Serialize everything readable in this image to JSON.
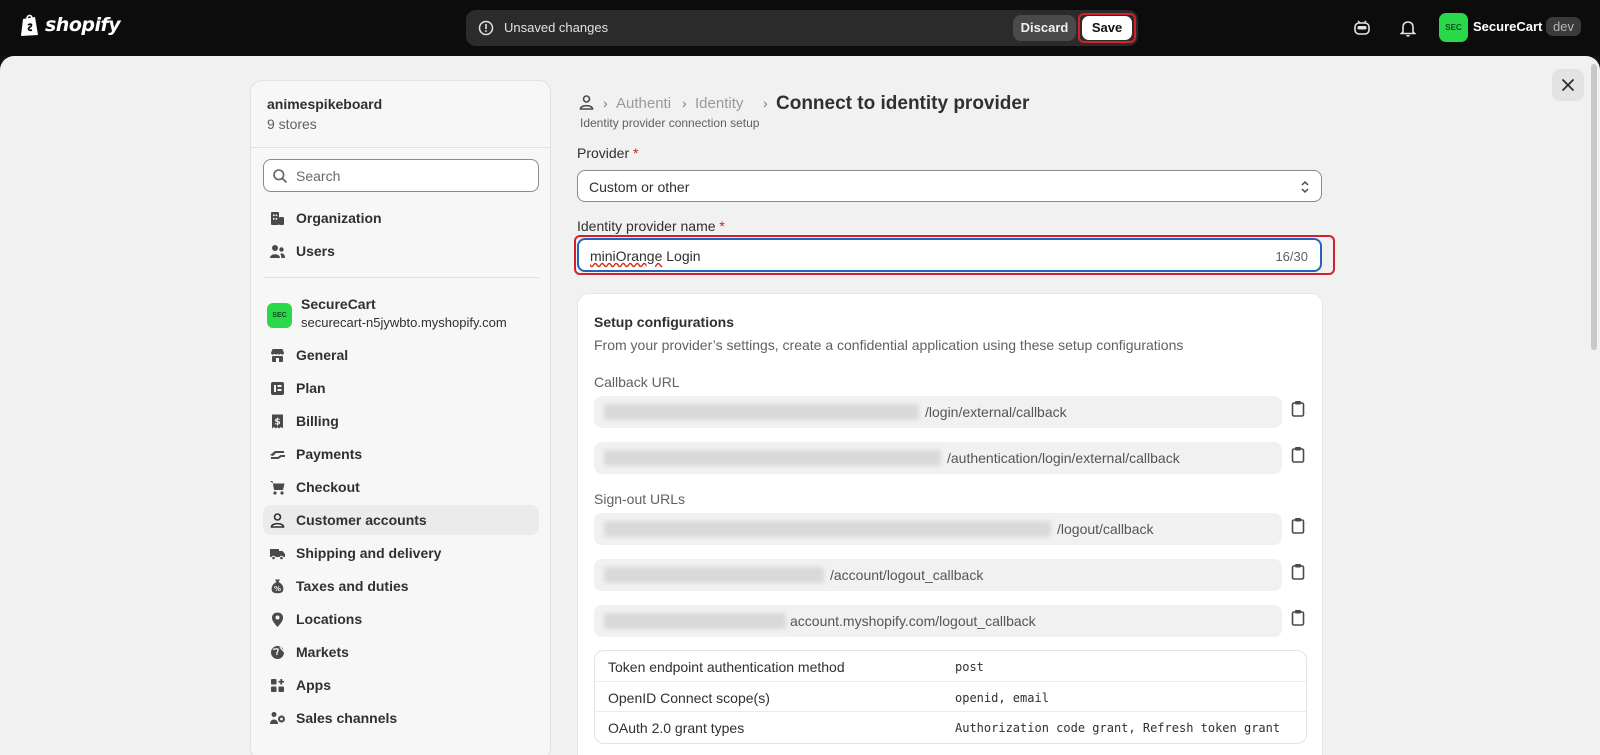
{
  "topbar": {
    "brand": "shopify",
    "unsaved_text": "Unsaved changes",
    "discard_label": "Discard",
    "save_label": "Save",
    "store_avatar": "SEC",
    "store_name": "SecureCart",
    "env_badge": "dev",
    "icons": [
      "shopify-bag-icon",
      "alert-circle-icon",
      "sidekick-icon",
      "bell-icon"
    ]
  },
  "sidebar": {
    "org_name": "animespikeboard",
    "org_stores": "9 stores",
    "search": {
      "placeholder": "Search",
      "value": ""
    },
    "org_items": [
      {
        "label": "Organization",
        "icon": "organization-icon"
      },
      {
        "label": "Users",
        "icon": "users-icon"
      }
    ],
    "store": {
      "avatar": "SEC",
      "name": "SecureCart",
      "domain": "securecart-n5jywbto.myshopify.com"
    },
    "items": [
      {
        "label": "General",
        "icon": "store-icon"
      },
      {
        "label": "Plan",
        "icon": "plan-icon"
      },
      {
        "label": "Billing",
        "icon": "billing-icon"
      },
      {
        "label": "Payments",
        "icon": "payments-icon"
      },
      {
        "label": "Checkout",
        "icon": "cart-icon"
      },
      {
        "label": "Customer accounts",
        "icon": "person-icon",
        "active": true
      },
      {
        "label": "Shipping and delivery",
        "icon": "truck-icon"
      },
      {
        "label": "Taxes and duties",
        "icon": "taxes-icon"
      },
      {
        "label": "Locations",
        "icon": "location-pin-icon"
      },
      {
        "label": "Markets",
        "icon": "globe-icon"
      },
      {
        "label": "Apps",
        "icon": "apps-icon"
      },
      {
        "label": "Sales channels",
        "icon": "sales-channels-icon"
      }
    ]
  },
  "breadcrumbs": {
    "items": [
      "Authenti",
      "Identity"
    ],
    "current": "Connect to identity provider",
    "subtitle": "Identity provider connection setup"
  },
  "form": {
    "provider_label": "Provider",
    "provider_value": "Custom or other",
    "name_label": "Identity provider name",
    "required_mark": "*",
    "name_value_part1": "miniOrange",
    "name_value_part2": " Login",
    "name_counter": "16/30"
  },
  "setup": {
    "title": "Setup configurations",
    "description": "From your provider’s settings, create a confidential application using these setup configurations",
    "callback_label": "Callback URL",
    "callback_urls": [
      "/login/external/callback",
      "/authentication/login/external/callback"
    ],
    "signout_label": "Sign-out URLs",
    "signout_urls": [
      "/logout/callback",
      "/account/logout_callback",
      "account.myshopify.com/logout_callback"
    ],
    "table": [
      {
        "key": "Token endpoint authentication method",
        "value": "post"
      },
      {
        "key": "OpenID Connect scope(s)",
        "value": "openid, email"
      },
      {
        "key": "OAuth 2.0 grant types",
        "value": "Authorization code grant, Refresh token grant"
      }
    ]
  }
}
